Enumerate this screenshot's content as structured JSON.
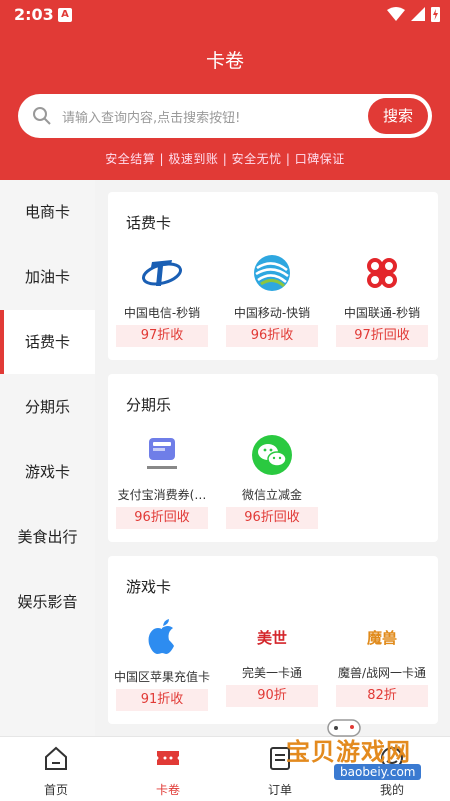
{
  "status": {
    "time": "2:03",
    "app_badge": "A"
  },
  "header": {
    "title": "卡卷",
    "search_placeholder": "请输入查询内容,点击搜索按钮!",
    "search_button": "搜索",
    "slogan": "安全结算 | 极速到账 | 安全无忧 | 口碑保证"
  },
  "sidebar": {
    "items": [
      {
        "label": "电商卡"
      },
      {
        "label": "加油卡"
      },
      {
        "label": "话费卡"
      },
      {
        "label": "分期乐"
      },
      {
        "label": "游戏卡"
      },
      {
        "label": "美食出行"
      },
      {
        "label": "娱乐影音"
      }
    ],
    "active": "话费卡"
  },
  "sections": [
    {
      "title": "话费卡",
      "items": [
        {
          "name": "中国电信-秒销",
          "rate": "97折收",
          "icon": "china-telecom-logo"
        },
        {
          "name": "中国移动-快销",
          "rate": "96折收",
          "icon": "china-mobile-logo"
        },
        {
          "name": "中国联通-秒销",
          "rate": "97折回收",
          "icon": "china-unicom-logo"
        }
      ]
    },
    {
      "title": "分期乐",
      "items": [
        {
          "name": "支付宝消费券(…",
          "rate": "96折回收",
          "icon": "alipay-coupon-logo"
        },
        {
          "name": "微信立减金",
          "rate": "96折回收",
          "icon": "wechat-logo"
        }
      ]
    },
    {
      "title": "游戏卡",
      "items": [
        {
          "name": "中国区苹果充值卡",
          "rate": "91折收",
          "icon": "apple-logo",
          "logo_text": ""
        },
        {
          "name": "完美一卡通",
          "rate": "90折",
          "icon": "perfect-world-logo",
          "logo_text": "美世"
        },
        {
          "name": "魔兽/战网一卡通",
          "rate": "82折",
          "icon": "warcraft-logo",
          "logo_text": "魔兽"
        }
      ]
    }
  ],
  "tabbar": {
    "items": [
      {
        "label": "首页",
        "icon": "home-icon"
      },
      {
        "label": "卡卷",
        "icon": "ticket-icon"
      },
      {
        "label": "订单",
        "icon": "order-icon"
      },
      {
        "label": "我的",
        "icon": "profile-icon"
      }
    ],
    "active": "卡卷"
  },
  "watermark": {
    "text": "宝贝游戏网",
    "url": "baobeiy.com"
  },
  "colors": {
    "brand": "#e13a36",
    "rate_bg": "#fdecec"
  }
}
